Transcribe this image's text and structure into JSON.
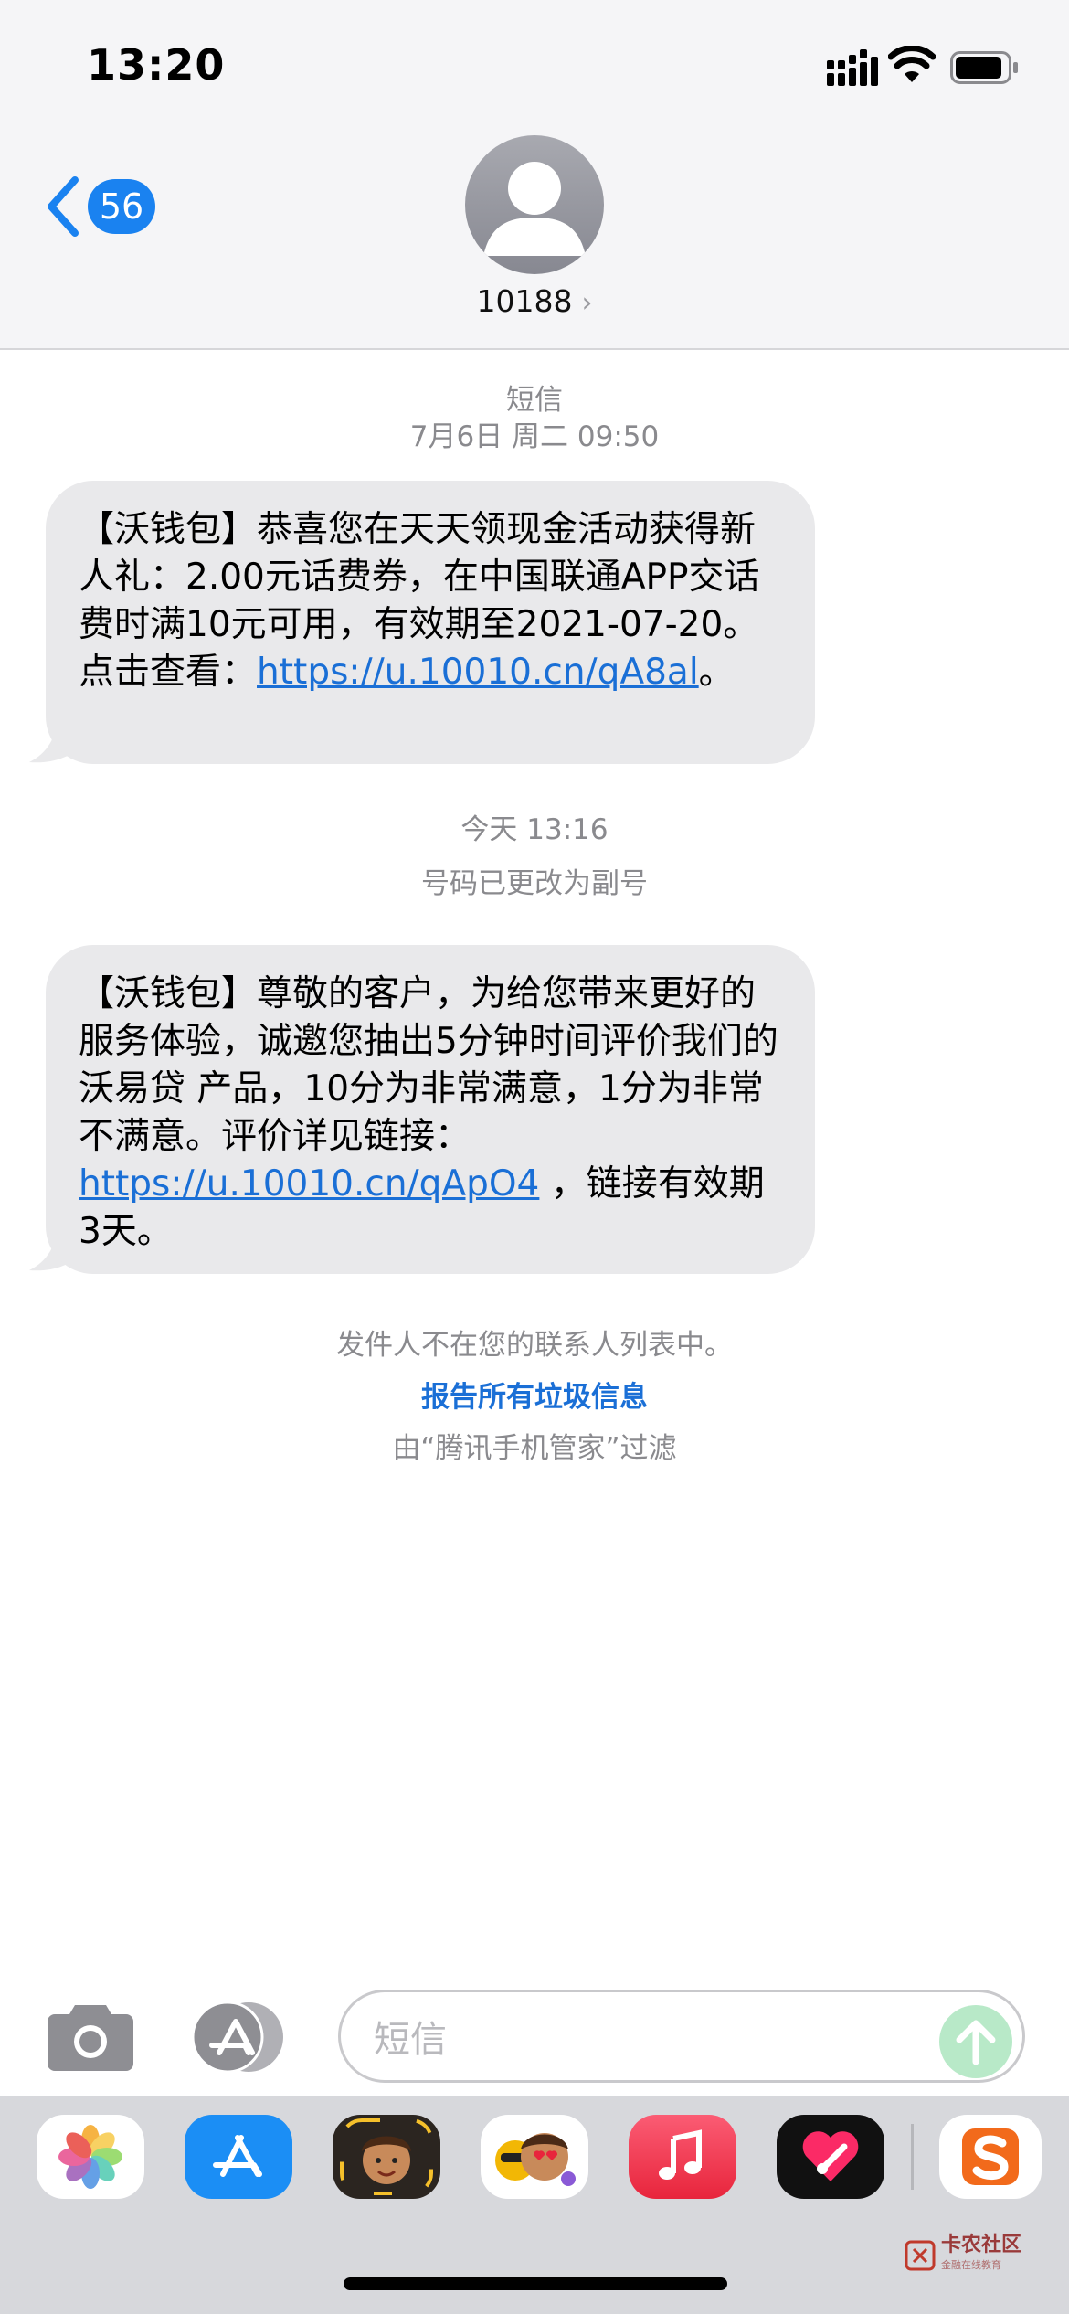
{
  "status_bar": {
    "time": "13:20"
  },
  "nav": {
    "back_count": "56",
    "contact": "10188",
    "contact_chevron": "›"
  },
  "thread": {
    "section1": {
      "label": "短信",
      "date": "7月6日 周二 09:50"
    },
    "message1": {
      "text_before_link": "【沃钱包】恭喜您在天天领现金活动获得新人礼：2.00元话费券，在中国联通APP交话费时满10元可用，有效期至2021-07-20。点击查看：",
      "link": "https://u.10010.cn/qA8al",
      "text_after_link": "。"
    },
    "section2": {
      "date": "今天 13:16",
      "note": "号码已更改为副号"
    },
    "message2": {
      "text_before_link": "【沃钱包】尊敬的客户，为给您带来更好的服务体验，诚邀您抽出5分钟时间评价我们的 沃易贷 产品，10分为非常满意，1分为非常不满意。评价详见链接：",
      "link": "https://u.10010.cn/qApO4",
      "text_after_link": " ，链接有效期3天。"
    },
    "notice": {
      "not_in_contacts": "发件人不在您的联系人列表中。",
      "report_link": "报告所有垃圾信息",
      "filtered_by": "由“腾讯手机管家”过滤"
    }
  },
  "composer": {
    "placeholder": "短信"
  },
  "tray": {
    "apps": [
      "photos-app",
      "app-store-app",
      "memoji-app",
      "animoji-stickers-app",
      "music-app",
      "digital-touch-app",
      "sogou-keyboard-app"
    ]
  },
  "watermark": {
    "text": "卡农社区",
    "subtitle": "金融在线教育"
  },
  "colors": {
    "accent": "#1a82f0",
    "bubble": "#e9e9eb",
    "header_bg": "#f5f5f7",
    "link": "#1a6fd6"
  }
}
